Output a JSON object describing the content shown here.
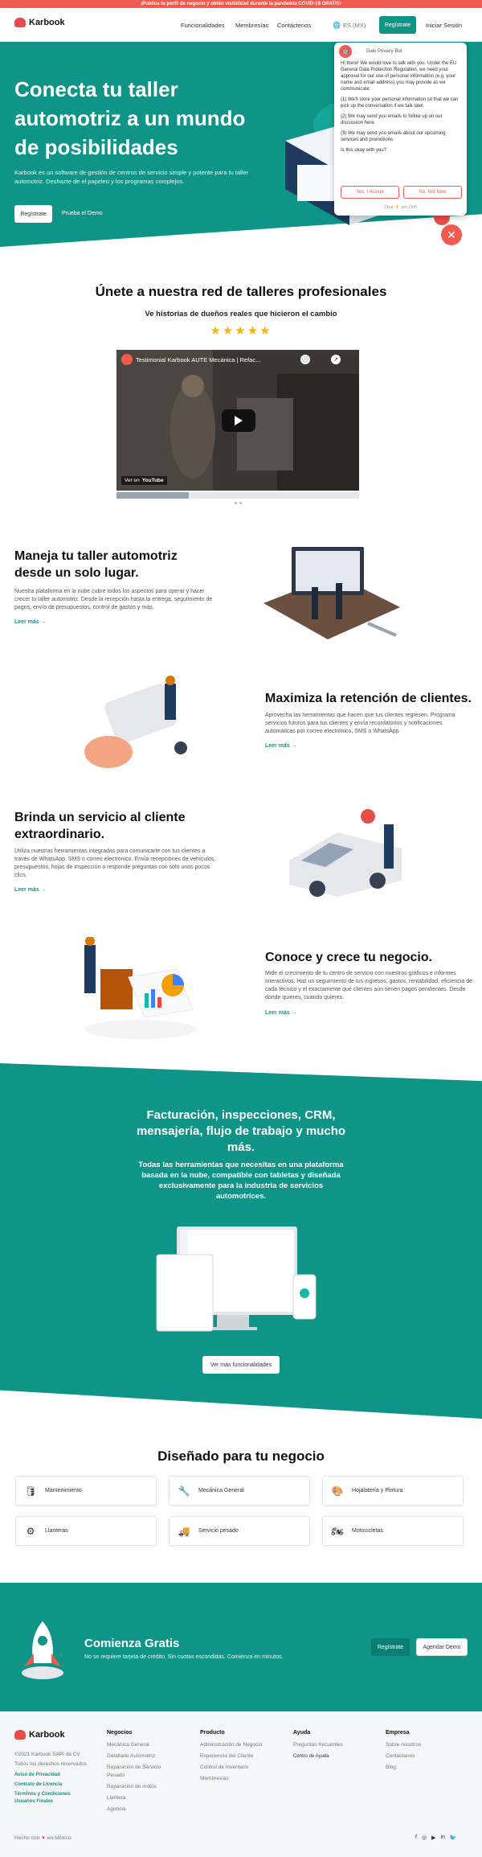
{
  "banner": "¡Publica tu perfil de negocio y obtén visibilidad durante la pandemia COVID-19 GRATIS!",
  "brand": {
    "name": "Karbook",
    "teal": "#0f9488",
    "red": "#f05a4f"
  },
  "nav": {
    "links": [
      "Funcionalidades",
      "Membresías",
      "Contáctenos"
    ],
    "language": "ES (MX)",
    "signup": "Regístrate",
    "login": "Iniciar Sesión"
  },
  "hero": {
    "title": "Conecta tu taller automotriz a un mundo de posibilidades",
    "subtitle": "Karbook es un software de gestión de centros de servicio simple y potente para tu taller automotriz. Deshazte de el papeleo y los programas complejos.",
    "primary_button": "Regístrate",
    "secondary_button": "Prueba el Demo"
  },
  "chat": {
    "bot_name": "Dale Privacy Bot",
    "messages": [
      "Hi there! We would love to talk with you. Under the EU General Data Protection Regulation, we need your approval for our use of personal information (e.g. your name and email address) you may provide as we communicate:",
      "(1) We'll store your personal information so that we can pick up the conversation if we talk later.",
      "(2) We may send you emails to follow up on our discussion here.",
      "(3) We may send you emails about our upcoming services and promotions.",
      "Is this okay with you?"
    ],
    "accept": "Yes, I Accept",
    "decline": "No, Not Now",
    "powered": "Chat ⚡ por Drift"
  },
  "network": {
    "title": "Únete a nuestra red de talleres profesionales",
    "subtitle": "Ve historias de dueños reales que hicieron el cambio",
    "rating": 5,
    "video_title": "Testimonial Karbook AUTE Mecánica | Refac...",
    "watch_on": "Ver en",
    "youtube": "YouTube"
  },
  "features": [
    {
      "title": "Maneja tu taller automotriz desde un solo lugar.",
      "text": "Nuestra plataforma en la nube cubre todos los aspectos para operar y hacer crecer tu taller automotriz. Desde la recepción hasta la entrega, seguimiento de pagos, envío de presupuestos, control de gastos y más.",
      "link": "Leer más →"
    },
    {
      "title": "Maximiza la retención de clientes.",
      "text": "Aprovecha las herramientas que hacen que tus clientes regresen. Programa servicios futuros para tus clientes y envía recordatorios y notificaciones automáticas por correo electrónico, SMS o WhatsApp.",
      "link": "Leer más →"
    },
    {
      "title": "Brinda un servicio al cliente extraordinario.",
      "text": "Utiliza nuestras herramientas integradas para comunicarte con tus clientes a través de WhatsApp, SMS o correo electrónico. Envía recepciones de vehículos, presupuestos, hojas de inspección o responde preguntas con solo unos pocos clics.",
      "link": "Leer más →"
    },
    {
      "title": "Conoce y crece tu negocio.",
      "text": "Mide el crecimiento de tu centro de servicio con nuestros gráficos e informes interactivos. Haz un seguimiento de tus ingresos, gastos, rentabilidad, eficiencia de cada técnico y el exactamente qué clientes aún tienen pagos pendientes. Desde donde quieres, cuando quieres.",
      "link": "Leer más →"
    }
  ],
  "platform": {
    "title": "Facturación, inspecciones, CRM, mensajería, flujo de trabajo y mucho más.",
    "subtitle": "Todas las herramientas que necesitas en una plataforma basada en la nube, compatible con tabletas y diseñada exclusivamente para la industria de servicios automotrices.",
    "button": "Ver más funcionalidades"
  },
  "designed": {
    "title": "Diseñado para tu negocio",
    "categories": [
      {
        "label": "Mantenimiento",
        "icon": "🛢"
      },
      {
        "label": "Mecánica General",
        "icon": "🔧"
      },
      {
        "label": "Hojalatería y Pintura",
        "icon": "🎨"
      },
      {
        "label": "Llanteras",
        "icon": "⚙"
      },
      {
        "label": "Servicio pesado",
        "icon": "🚚"
      },
      {
        "label": "Motocicletas",
        "icon": "🏍"
      }
    ]
  },
  "cta": {
    "title": "Comienza Gratis",
    "subtitle": "No se requiere tarjeta de crédito. Sin cuotas escondidas. Comienza en minutos.",
    "signup": "Regístrate",
    "demo": "Agendar Demo"
  },
  "footer": {
    "copyright": "©2021 Karbook SAPI de CV",
    "rights": "Todos los derechos reservados",
    "legal": [
      "Aviso de Privacidad",
      "Contrato de Licencia",
      "Términos y Condiciones Usuarios Finales"
    ],
    "made": "Hecho con",
    "made_in": "en México",
    "columns": [
      {
        "title": "Negocios",
        "items": [
          "Mecánica General",
          "Detallado Automotriz",
          "Reparación de Servicio Pesado",
          "Reparación de motos",
          "Llantera",
          "Agencia"
        ]
      },
      {
        "title": "Producto",
        "items": [
          "Administración de Negocio",
          "Experiencia del Cliente",
          "Control de Inventario",
          "Membresías"
        ]
      },
      {
        "title": "Ayuda",
        "items": [
          "Preguntas frecuentes",
          "Centro de Ayuda"
        ]
      },
      {
        "title": "Empresa",
        "items": [
          "Sobre nosotros",
          "Contáctanos",
          "Blog"
        ]
      }
    ],
    "social_icons": [
      "facebook-icon",
      "instagram-icon",
      "youtube-icon",
      "linkedin-icon",
      "twitter-icon"
    ]
  }
}
